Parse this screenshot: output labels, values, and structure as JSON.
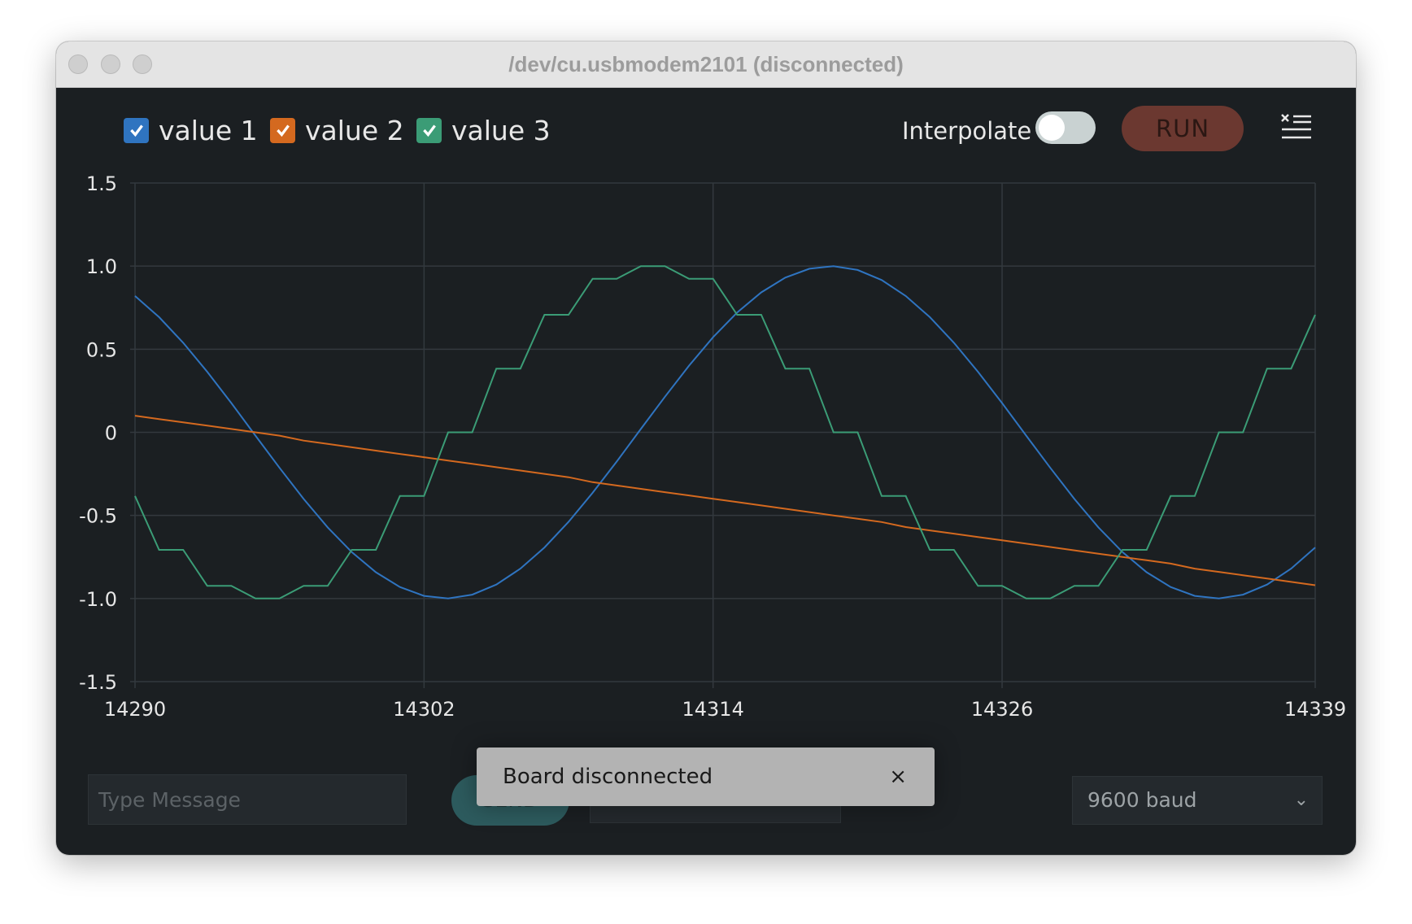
{
  "window": {
    "title": "/dev/cu.usbmodem2101 (disconnected)"
  },
  "toolbar": {
    "legend": [
      {
        "label": "value 1",
        "checked": true,
        "color": "#2f74c0"
      },
      {
        "label": "value 2",
        "checked": true,
        "color": "#d4691f"
      },
      {
        "label": "value 3",
        "checked": true,
        "color": "#3b9c76"
      }
    ],
    "interpolate_label": "Interpolate",
    "interpolate_on": false,
    "run_label": "RUN",
    "menu_icon": "clear-list-icon"
  },
  "chart_data": {
    "type": "line",
    "xlim": [
      14290,
      14339
    ],
    "ylim": [
      -1.5,
      1.5
    ],
    "x_ticks": [
      "14290",
      "14302",
      "14314",
      "14326",
      "14339"
    ],
    "y_ticks": [
      "1.5",
      "1.0",
      "0.5",
      "0",
      "-0.5",
      "-1.0",
      "-1.5"
    ],
    "grid": true,
    "x_start": 14290,
    "series": [
      {
        "name": "value 1",
        "color": "#2f74c0",
        "values": [
          0.82,
          0.693,
          0.539,
          0.364,
          0.176,
          -0.02,
          -0.214,
          -0.401,
          -0.572,
          -0.721,
          -0.842,
          -0.931,
          -0.984,
          -1.0,
          -0.977,
          -0.916,
          -0.82,
          -0.693,
          -0.539,
          -0.364,
          -0.176,
          0.02,
          0.214,
          0.401,
          0.572,
          0.721,
          0.842,
          0.931,
          0.984,
          1.0,
          0.977,
          0.916,
          0.82,
          0.693,
          0.539,
          0.364,
          0.176,
          -0.02,
          -0.214,
          -0.401,
          -0.572,
          -0.721,
          -0.842,
          -0.931,
          -0.984,
          -1.0,
          -0.977,
          -0.916,
          -0.82,
          -0.693
        ]
      },
      {
        "name": "value 2",
        "color": "#d4691f",
        "values": [
          0.1,
          0.08,
          0.06,
          0.04,
          0.02,
          0.0,
          -0.02,
          -0.05,
          -0.07,
          -0.09,
          -0.11,
          -0.13,
          -0.15,
          -0.17,
          -0.19,
          -0.21,
          -0.23,
          -0.25,
          -0.27,
          -0.3,
          -0.32,
          -0.34,
          -0.36,
          -0.38,
          -0.4,
          -0.42,
          -0.44,
          -0.46,
          -0.48,
          -0.5,
          -0.52,
          -0.54,
          -0.57,
          -0.59,
          -0.61,
          -0.63,
          -0.65,
          -0.67,
          -0.69,
          -0.71,
          -0.73,
          -0.75,
          -0.77,
          -0.79,
          -0.82,
          -0.84,
          -0.86,
          -0.88,
          -0.9,
          -0.92
        ]
      },
      {
        "name": "value 3",
        "color": "#3b9c76",
        "values": [
          -0.383,
          -0.707,
          -0.707,
          -0.924,
          -0.924,
          -1,
          -1,
          -0.924,
          -0.924,
          -0.707,
          -0.707,
          -0.383,
          -0.383,
          0,
          0,
          0.383,
          0.383,
          0.707,
          0.707,
          0.924,
          0.924,
          1,
          1,
          0.924,
          0.924,
          0.707,
          0.707,
          0.383,
          0.383,
          0,
          0,
          -0.383,
          -0.383,
          -0.707,
          -0.707,
          -0.924,
          -0.924,
          -1,
          -1,
          -0.924,
          -0.924,
          -0.707,
          -0.707,
          -0.383,
          -0.383,
          0,
          0,
          0.383,
          0.383,
          0.707
        ]
      }
    ]
  },
  "footer": {
    "message_placeholder": "Type Message",
    "send_label": "SEND",
    "baud_value": "9600 baud"
  },
  "toast": {
    "text": "Board disconnected",
    "close_label": "×"
  }
}
